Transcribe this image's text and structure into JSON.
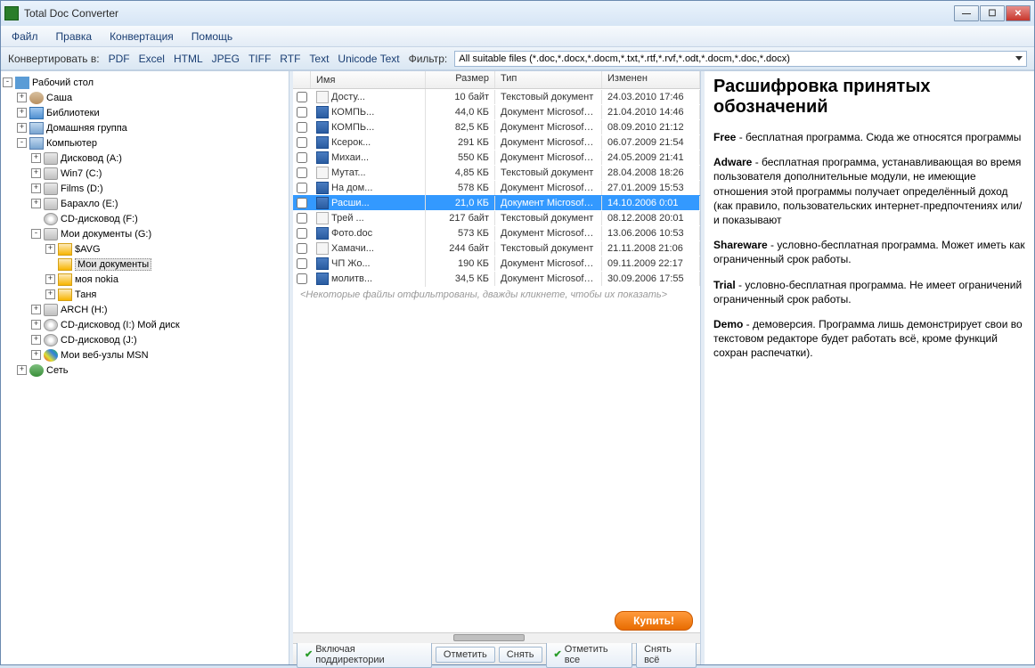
{
  "window": {
    "title": "Total Doc Converter"
  },
  "menu": {
    "file": "Файл",
    "edit": "Правка",
    "convert": "Конвертация",
    "help": "Помощь"
  },
  "toolbar": {
    "convert_label": "Конвертировать в:",
    "formats": [
      "PDF",
      "Excel",
      "HTML",
      "JPEG",
      "TIFF",
      "RTF",
      "Text",
      "Unicode Text"
    ],
    "filter_label": "Фильтр:",
    "filter_value": "All suitable files (*.doc,*.docx,*.docm,*.txt,*.rtf,*.rvf,*.odt,*.docm,*.doc,*.docx)"
  },
  "tree": [
    {
      "indent": 0,
      "toggle": "-",
      "icon": "desktop",
      "label": "Рабочий стол"
    },
    {
      "indent": 1,
      "toggle": "+",
      "icon": "user",
      "label": "Саша"
    },
    {
      "indent": 1,
      "toggle": "+",
      "icon": "library",
      "label": "Библиотеки"
    },
    {
      "indent": 1,
      "toggle": "+",
      "icon": "computer",
      "label": "Домашняя группа"
    },
    {
      "indent": 1,
      "toggle": "-",
      "icon": "computer",
      "label": "Компьютер"
    },
    {
      "indent": 2,
      "toggle": "+",
      "icon": "drive",
      "label": "Дисковод (A:)"
    },
    {
      "indent": 2,
      "toggle": "+",
      "icon": "drive",
      "label": "Win7 (C:)"
    },
    {
      "indent": 2,
      "toggle": "+",
      "icon": "drive",
      "label": "Films (D:)"
    },
    {
      "indent": 2,
      "toggle": "+",
      "icon": "drive",
      "label": "Барахло (E:)"
    },
    {
      "indent": 2,
      "toggle": " ",
      "icon": "cd",
      "label": "CD-дисковод (F:)"
    },
    {
      "indent": 2,
      "toggle": "-",
      "icon": "drive",
      "label": "Мои документы (G:)"
    },
    {
      "indent": 3,
      "toggle": "+",
      "icon": "folder",
      "label": "$AVG"
    },
    {
      "indent": 3,
      "toggle": " ",
      "icon": "folder",
      "label": "Мои документы",
      "selected": true
    },
    {
      "indent": 3,
      "toggle": "+",
      "icon": "folder",
      "label": "моя nokia"
    },
    {
      "indent": 3,
      "toggle": "+",
      "icon": "folder",
      "label": "Таня"
    },
    {
      "indent": 2,
      "toggle": "+",
      "icon": "drive",
      "label": "ARCH (H:)"
    },
    {
      "indent": 2,
      "toggle": "+",
      "icon": "cd",
      "label": "CD-дисковод (I:) Мой диск"
    },
    {
      "indent": 2,
      "toggle": "+",
      "icon": "cd",
      "label": "CD-дисковод (J:)"
    },
    {
      "indent": 2,
      "toggle": "+",
      "icon": "msn",
      "label": "Мои веб-узлы MSN"
    },
    {
      "indent": 1,
      "toggle": "+",
      "icon": "network",
      "label": "Сеть"
    }
  ],
  "file_columns": {
    "name": "Имя",
    "size": "Размер",
    "type": "Тип",
    "modified": "Изменен"
  },
  "files": [
    {
      "name": "Досту...",
      "icon": "txt",
      "size": "10 байт",
      "type": "Текстовый документ",
      "modified": "24.03.2010 17:46"
    },
    {
      "name": "КОМПЬ...",
      "icon": "doc",
      "size": "44,0 КБ",
      "type": "Документ Microsoft ...",
      "modified": "21.04.2010 14:46"
    },
    {
      "name": "КОМПЬ...",
      "icon": "doc",
      "size": "82,5 КБ",
      "type": "Документ Microsoft ...",
      "modified": "08.09.2010 21:12"
    },
    {
      "name": "Ксерок...",
      "icon": "doc",
      "size": "291 КБ",
      "type": "Документ Microsoft ...",
      "modified": "06.07.2009 21:54"
    },
    {
      "name": "Михаи...",
      "icon": "doc",
      "size": "550 КБ",
      "type": "Документ Microsoft ...",
      "modified": "24.05.2009 21:41"
    },
    {
      "name": "Мутат...",
      "icon": "txt",
      "size": "4,85 КБ",
      "type": "Текстовый документ",
      "modified": "28.04.2008 18:26"
    },
    {
      "name": "На дом...",
      "icon": "doc",
      "size": "578 КБ",
      "type": "Документ Microsoft ...",
      "modified": "27.01.2009 15:53"
    },
    {
      "name": "Расши...",
      "icon": "doc",
      "size": "21,0 КБ",
      "type": "Документ Microsoft ...",
      "modified": "14.10.2006 0:01",
      "selected": true
    },
    {
      "name": "Трей ...",
      "icon": "txt",
      "size": "217 байт",
      "type": "Текстовый документ",
      "modified": "08.12.2008 20:01"
    },
    {
      "name": "Фото.doc",
      "icon": "doc",
      "size": "573 КБ",
      "type": "Документ Microsoft ...",
      "modified": "13.06.2006 10:53"
    },
    {
      "name": "Хамачи...",
      "icon": "txt",
      "size": "244 байт",
      "type": "Текстовый документ",
      "modified": "21.11.2008 21:06"
    },
    {
      "name": "ЧП Жо...",
      "icon": "doc",
      "size": "190 КБ",
      "type": "Документ Microsoft ...",
      "modified": "09.11.2009 22:17"
    },
    {
      "name": "молитв...",
      "icon": "doc",
      "size": "34,5 КБ",
      "type": "Документ Microsoft ...",
      "modified": "30.09.2006 17:55"
    }
  ],
  "filter_note": "<Некоторые файлы отфильтрованы, дважды кликнете, чтобы их показать>",
  "buy_label": "Купить!",
  "actions": {
    "include_subdirs": "Включая поддиректории",
    "check": "Отметить",
    "uncheck": "Снять",
    "check_all": "Отметить все",
    "uncheck_all": "Снять всё"
  },
  "preview": {
    "title": "Расшифровка принятых обозначений",
    "paragraphs": [
      {
        "bold": "Free",
        "text": " - бесплатная программа. Сюда же относятся программы"
      },
      {
        "bold": "Adware",
        "text": " - бесплатная программа, устанавливающая во время пользователя дополнительные модули, не имеющие отношения этой программы получает определённый доход (как правило, пользовательских интернет-предпочтениях или/и показывают"
      },
      {
        "bold": "Shareware",
        "text": " - условно-бесплатная программа. Может иметь как ограниченный срок работы."
      },
      {
        "bold": "Trial",
        "text": " - условно-бесплатная программа. Не имеет ограничений ограниченный срок работы."
      },
      {
        "bold": "Demo",
        "text": " - демоверсия. Программа лишь демонстрирует свои во текстовом редакторе будет работать всё, кроме функций сохран распечатки)."
      }
    ]
  }
}
